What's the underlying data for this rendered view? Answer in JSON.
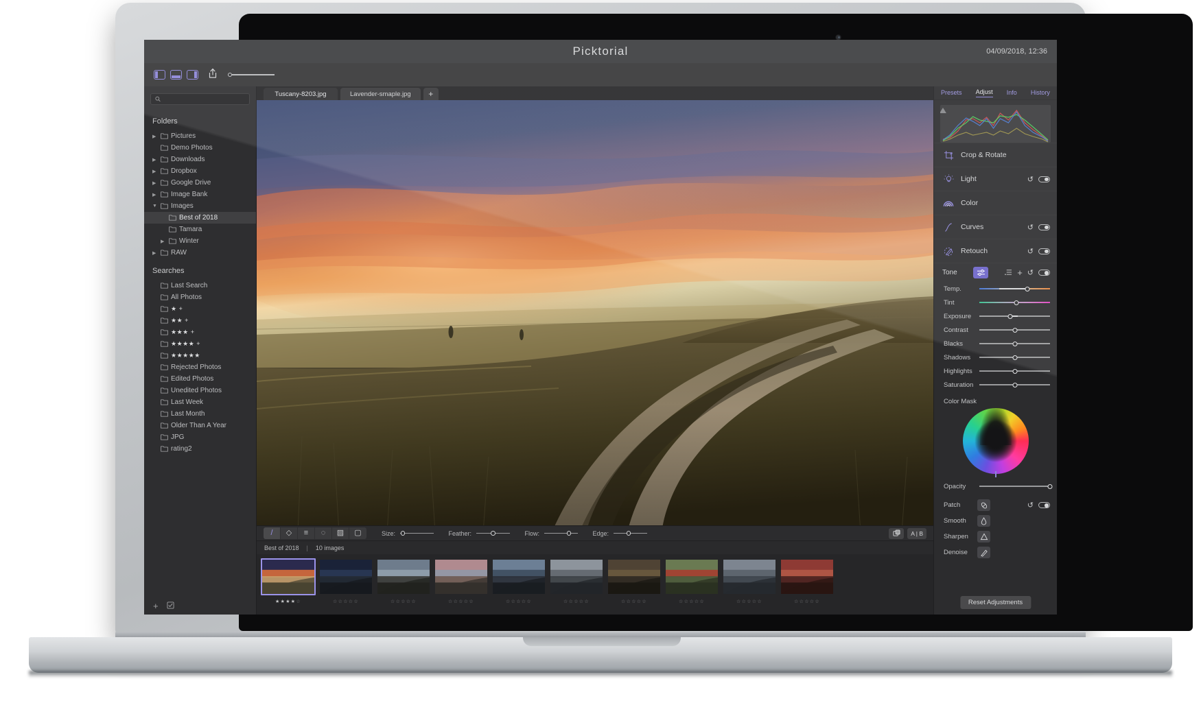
{
  "window": {
    "title": "Picktorial",
    "datetime": "04/09/2018, 12:36"
  },
  "toolbar": {
    "panel_left_label": "left-panel-toggle",
    "panel_bottom_label": "bottom-panel-toggle",
    "panel_right_label": "right-panel-toggle",
    "share_label": "share",
    "zoom_label": "zoom"
  },
  "sidebar": {
    "search": {
      "value": "",
      "placeholder": ""
    },
    "folders_title": "Folders",
    "folders": [
      {
        "label": "Pictures",
        "indent": 0,
        "disclosure": "closed",
        "selected": false
      },
      {
        "label": "Demo Photos",
        "indent": 0,
        "disclosure": "none",
        "selected": false
      },
      {
        "label": "Downloads",
        "indent": 0,
        "disclosure": "closed",
        "selected": false
      },
      {
        "label": "Dropbox",
        "indent": 0,
        "disclosure": "closed",
        "selected": false
      },
      {
        "label": "Google Drive",
        "indent": 0,
        "disclosure": "closed",
        "selected": false
      },
      {
        "label": "Image Bank",
        "indent": 0,
        "disclosure": "closed",
        "selected": false
      },
      {
        "label": "Images",
        "indent": 0,
        "disclosure": "open",
        "selected": false
      },
      {
        "label": "Best of 2018",
        "indent": 1,
        "disclosure": "none",
        "selected": true
      },
      {
        "label": "Tamara",
        "indent": 1,
        "disclosure": "none",
        "selected": false
      },
      {
        "label": "Winter",
        "indent": 1,
        "disclosure": "closed",
        "selected": false
      },
      {
        "label": "RAW",
        "indent": 0,
        "disclosure": "closed",
        "selected": false
      }
    ],
    "searches_title": "Searches",
    "searches": [
      {
        "label": "Last Search"
      },
      {
        "label": "All Photos"
      },
      {
        "label": "★ +"
      },
      {
        "label": "★★ +"
      },
      {
        "label": "★★★ +"
      },
      {
        "label": "★★★★ +"
      },
      {
        "label": "★★★★★"
      },
      {
        "label": "Rejected Photos"
      },
      {
        "label": "Edited Photos"
      },
      {
        "label": "Unedited Photos"
      },
      {
        "label": "Last Week"
      },
      {
        "label": "Last Month"
      },
      {
        "label": "Older Than A Year"
      },
      {
        "label": "JPG"
      },
      {
        "label": "rating2"
      }
    ],
    "footer": {
      "add_label": "+",
      "edit_label": "edit"
    }
  },
  "file_tabs": [
    {
      "label": "Tuscany-8203.jpg",
      "active": true
    },
    {
      "label": "Lavender-smaple.jpg",
      "active": false
    }
  ],
  "file_tab_add": "+",
  "brush_toolbar": {
    "tools": [
      {
        "name": "brush-tool",
        "glyph": "/",
        "active": true
      },
      {
        "name": "eraser-tool",
        "glyph": "◇",
        "active": false
      },
      {
        "name": "gradient-tool",
        "glyph": "≡",
        "active": false
      },
      {
        "name": "radial-tool",
        "glyph": "◌",
        "active": false
      },
      {
        "name": "pattern-tool",
        "glyph": "▨",
        "active": false
      },
      {
        "name": "rect-tool",
        "glyph": "▢",
        "active": false
      }
    ],
    "sliders": [
      {
        "label": "Size:",
        "value": 2
      },
      {
        "label": "Feather:",
        "value": 50
      },
      {
        "label": "Flow:",
        "value": 78
      },
      {
        "label": "Edge:",
        "value": 45
      }
    ],
    "compare_label": "compare",
    "ab_label": "A | B"
  },
  "status": {
    "collection": "Best of 2018",
    "separator": "|",
    "count": "10 images"
  },
  "filmstrip": {
    "items": [
      {
        "name": "tuscany-sunset",
        "stars": 4,
        "selected": true,
        "colors": [
          "#2b2a4e",
          "#e0703a",
          "#c6a06a",
          "#4a4431"
        ]
      },
      {
        "name": "night-sky",
        "stars": 0,
        "selected": false,
        "colors": [
          "#1a2238",
          "#2b3a57",
          "#242a33",
          "#171a1f"
        ]
      },
      {
        "name": "waterfall-cliff",
        "stars": 0,
        "selected": false,
        "colors": [
          "#6e7c8c",
          "#93a2ae",
          "#3a3b36",
          "#22231f"
        ]
      },
      {
        "name": "snow-ridge",
        "stars": 0,
        "selected": false,
        "colors": [
          "#b08a8f",
          "#8f98a8",
          "#6d5a52",
          "#34302c"
        ]
      },
      {
        "name": "coastal-dusk",
        "stars": 0,
        "selected": false,
        "colors": [
          "#6c7f95",
          "#3b4a5c",
          "#2a2f36",
          "#1a1d22"
        ]
      },
      {
        "name": "rocky-shore",
        "stars": 0,
        "selected": false,
        "colors": [
          "#8d949c",
          "#5e646b",
          "#3a3e43",
          "#23262a"
        ]
      },
      {
        "name": "autumn-field",
        "stars": 0,
        "selected": false,
        "colors": [
          "#4f4334",
          "#6b5a3f",
          "#2f2a22",
          "#1b1813"
        ]
      },
      {
        "name": "poppy-field",
        "stars": 0,
        "selected": false,
        "colors": [
          "#6a7a52",
          "#a93b2e",
          "#4d5a3b",
          "#2b3122"
        ]
      },
      {
        "name": "misty-lake",
        "stars": 0,
        "selected": false,
        "colors": [
          "#7d8590",
          "#575f69",
          "#3c424a",
          "#262a2f"
        ]
      },
      {
        "name": "red-abstract",
        "stars": 0,
        "selected": false,
        "colors": [
          "#8e3a34",
          "#b55a48",
          "#4a2420",
          "#2a1512"
        ]
      }
    ]
  },
  "right_panel": {
    "tabs": [
      {
        "label": "Presets",
        "active": false
      },
      {
        "label": "Adjust",
        "active": true
      },
      {
        "label": "Info",
        "active": false
      },
      {
        "label": "History",
        "active": false
      }
    ],
    "adjustments": [
      {
        "label": "Crop & Rotate",
        "icon": "crop-icon",
        "has_controls": false
      },
      {
        "label": "Light",
        "icon": "light-icon",
        "has_controls": true
      },
      {
        "label": "Color",
        "icon": "color-icon",
        "has_controls": false
      },
      {
        "label": "Curves",
        "icon": "curves-icon",
        "has_controls": true
      },
      {
        "label": "Retouch",
        "icon": "retouch-icon",
        "has_controls": true
      }
    ],
    "tone": {
      "label": "Tone",
      "list_icon": "list-icon",
      "add_icon": "+",
      "reset_icon": "reset-icon",
      "toggle": "on"
    },
    "sliders": [
      {
        "label": "Temp.",
        "value": 68,
        "style": "temp"
      },
      {
        "label": "Tint",
        "value": 52,
        "style": "tint"
      },
      {
        "label": "Exposure",
        "value": 44,
        "style": "plain",
        "fill": true
      },
      {
        "label": "Contrast",
        "value": 50,
        "style": "plain"
      },
      {
        "label": "Blacks",
        "value": 50,
        "style": "plain"
      },
      {
        "label": "Shadows",
        "value": 50,
        "style": "plain"
      },
      {
        "label": "Highlights",
        "value": 50,
        "style": "plain"
      },
      {
        "label": "Saturation",
        "value": 50,
        "style": "plain"
      }
    ],
    "color_mask_label": "Color Mask",
    "opacity": {
      "label": "Opacity",
      "value": 100
    },
    "tools": [
      {
        "label": "Patch",
        "icon": "patch-icon",
        "has_controls": true
      },
      {
        "label": "Smooth",
        "icon": "droplet-icon",
        "has_controls": false
      },
      {
        "label": "Sharpen",
        "icon": "triangle-icon",
        "has_controls": false
      },
      {
        "label": "Denoise",
        "icon": "denoise-icon",
        "has_controls": false
      }
    ],
    "reset_button": "Reset Adjustments"
  },
  "colors": {
    "accent": "#8b84d8",
    "panel_bg": "#2c2c2e",
    "sidebar_bg": "#2e2e30",
    "selection": "#9b93ea"
  }
}
